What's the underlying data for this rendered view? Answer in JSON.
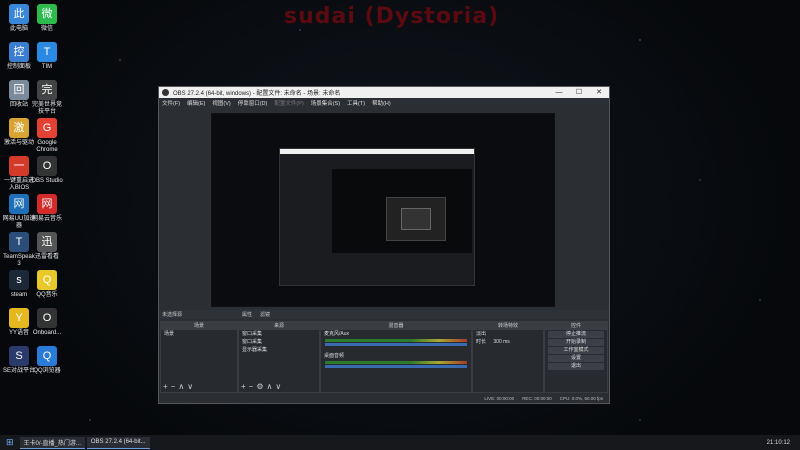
{
  "background": {
    "title": "sudai (Dystoria)",
    "title_color": "#5a0a10"
  },
  "desktop_icons": [
    {
      "label": "此电脑",
      "icon": "computer-icon",
      "color": "#3a86d8"
    },
    {
      "label": "微信",
      "icon": "wechat-icon",
      "color": "#2dbb4e"
    },
    {
      "label": "控制面板",
      "icon": "control-panel-icon",
      "color": "#3b7ed0"
    },
    {
      "label": "TIM",
      "icon": "tim-icon",
      "color": "#2a8ae2"
    },
    {
      "label": "回收站",
      "icon": "recycle-bin-icon",
      "color": "#7a8a9a"
    },
    {
      "label": "完美世界竞技平台",
      "icon": "perfect-world-icon",
      "color": "#444"
    },
    {
      "label": "激活与驱动",
      "icon": "folder-icon",
      "color": "#d9a431"
    },
    {
      "label": "Google Chrome",
      "icon": "chrome-icon",
      "color": "#e34133"
    },
    {
      "label": "一键重启进入BIOS",
      "icon": "bios-icon",
      "color": "#d43a2a"
    },
    {
      "label": "OBS Studio",
      "icon": "obs-icon",
      "color": "#333"
    },
    {
      "label": "网易UU加速器",
      "icon": "uu-icon",
      "color": "#1d6fb8"
    },
    {
      "label": "网易云音乐",
      "icon": "netease-music-icon",
      "color": "#d32a2a"
    },
    {
      "label": "TeamSpeak 3",
      "icon": "teamspeak-icon",
      "color": "#2a4d7a"
    },
    {
      "label": "迅雷看看",
      "icon": "xunlei-icon",
      "color": "#555"
    },
    {
      "label": "steam",
      "icon": "steam-icon",
      "color": "#1b2838"
    },
    {
      "label": "QQ音乐",
      "icon": "qqmusic-icon",
      "color": "#e9c82a"
    },
    {
      "label": "YY语音",
      "icon": "yy-icon",
      "color": "#e6b820"
    },
    {
      "label": "Onboard...",
      "icon": "onboard-icon",
      "color": "#333"
    },
    {
      "label": "SE对战平台",
      "icon": "se-icon",
      "color": "#2a3a6a"
    },
    {
      "label": "QQ浏览器",
      "icon": "qqbrowser-icon",
      "color": "#2a7ad8"
    }
  ],
  "obs": {
    "title": "OBS 27.2.4 (64-bit, windows) - 配置文件: 未命名 - 场景: 未命名",
    "menu": [
      "文件(F)",
      "编辑(E)",
      "视图(V)",
      "停靠窗口(D)",
      "配置文件(P)",
      "场景集合(S)",
      "工具(T)",
      "帮助(H)"
    ],
    "scene_bar": {
      "label": "未选择源",
      "props": "属性",
      "filters": "滤镜"
    },
    "panels": {
      "scenes": {
        "title": "场景",
        "items": [
          "场景"
        ]
      },
      "sources": {
        "title": "来源",
        "items": [
          "窗口采集",
          "窗口采集",
          "显示器采集"
        ]
      },
      "mixer": {
        "title": "混音器",
        "tracks": [
          {
            "name": "麦克风/Aux",
            "db": "0.0 dB"
          },
          {
            "name": "桌面音频",
            "db": "0.0 dB"
          }
        ]
      },
      "transitions": {
        "title": "转场特效",
        "type": "淡出",
        "duration_label": "时长",
        "duration": "300 ms"
      },
      "controls": {
        "title": "控件",
        "buttons": [
          "停止推流",
          "开始录制",
          "工作室模式",
          "设置",
          "退出"
        ]
      }
    },
    "status": {
      "live": "LIVE: 00:00:00",
      "rec": "REC: 00:00:00",
      "cpu": "CPU: 0.0%, 60.00 fps"
    }
  },
  "taskbar": {
    "items": [
      "王卡0/-直播_热门游...",
      "OBS 27.2.4 (64-bit..."
    ],
    "clock": "21:10:12"
  }
}
